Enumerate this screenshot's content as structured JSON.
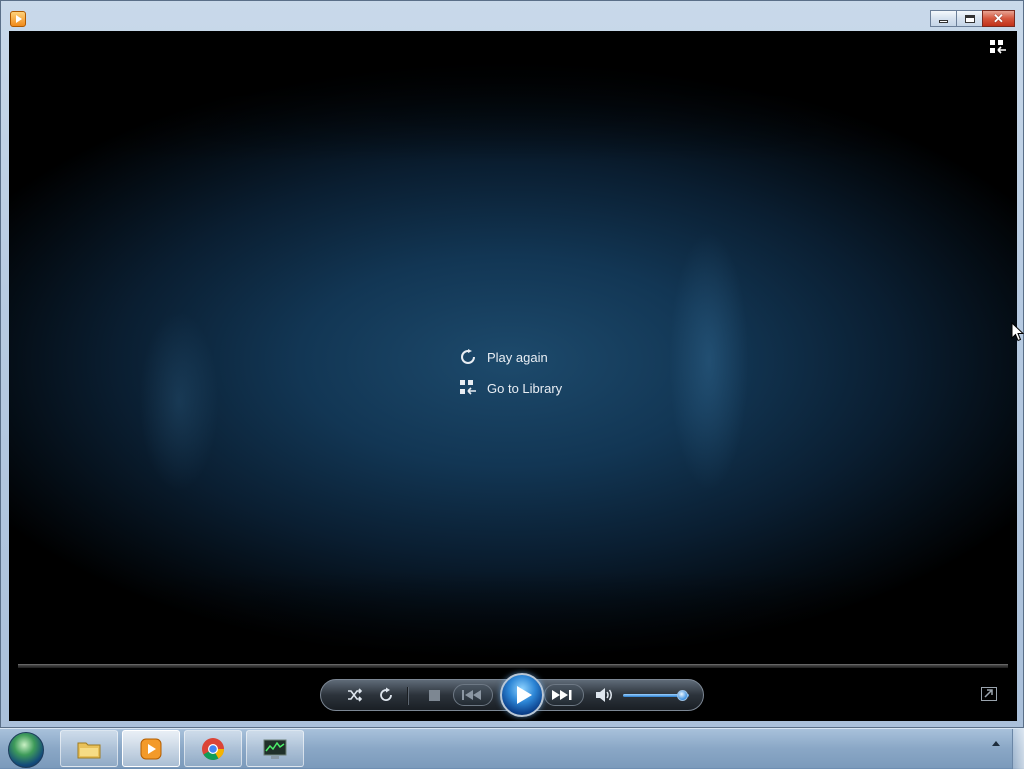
{
  "window": {
    "controls": {
      "minimize_icon": "minimize-icon",
      "maximize_icon": "maximize-icon",
      "close_icon": "close-icon",
      "close_glyph": "✕"
    }
  },
  "player": {
    "menu": [
      {
        "label": "Play again",
        "icon": "replay-icon"
      },
      {
        "label": "Go to Library",
        "icon": "library-icon"
      }
    ],
    "volume_level": 0.9,
    "seek_progress": 0,
    "accent_color": "#2d86d6"
  },
  "controls": {
    "icons": [
      "shuffle-icon",
      "repeat-icon",
      "stop-icon",
      "previous-icon",
      "play-icon",
      "next-icon",
      "volume-icon",
      "switch-to-now-playing-icon"
    ]
  },
  "taskbar": {
    "items": [
      {
        "name": "windows-explorer",
        "icon": "folder-icon"
      },
      {
        "name": "windows-media-player",
        "icon": "media-player-icon",
        "active": true
      },
      {
        "name": "google-chrome",
        "icon": "chrome-icon"
      },
      {
        "name": "task-manager",
        "icon": "monitor-icon"
      }
    ]
  }
}
